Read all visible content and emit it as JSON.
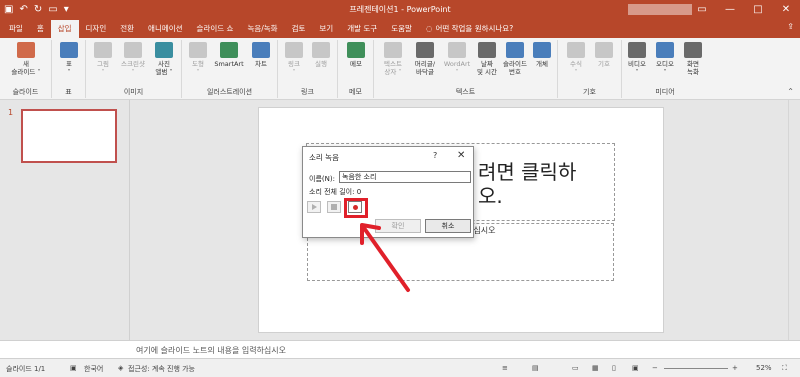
{
  "window": {
    "title": "프레젠테이션1 - PowerPoint",
    "qat_icons": [
      "save-icon",
      "undo-icon",
      "redo-icon",
      "start-slideshow-icon",
      "customize-icon"
    ],
    "controls": [
      "minimize-icon",
      "restore-icon",
      "maximize-icon",
      "close-icon"
    ]
  },
  "tabs": [
    "파일",
    "홈",
    "삽입",
    "디자인",
    "전환",
    "애니메이션",
    "슬라이드 쇼",
    "녹음/녹화",
    "검토",
    "보기",
    "개발 도구",
    "도움말"
  ],
  "tell_me": "어떤 작업을 원하시나요?",
  "share_icon": "share-icon",
  "ribbon": {
    "groups": [
      {
        "label": "슬라이드",
        "buttons": [
          {
            "label": "새\n슬라이드 ˅",
            "icon": "new-slide-icon",
            "enabled": true
          }
        ]
      },
      {
        "label": "표",
        "buttons": [
          {
            "label": "표\n˅",
            "icon": "table-icon",
            "enabled": true
          }
        ]
      },
      {
        "label": "이미지",
        "buttons": [
          {
            "label": "그림\n˅",
            "icon": "picture-icon",
            "enabled": false
          },
          {
            "label": "스크린샷\n˅",
            "icon": "screenshot-icon",
            "enabled": false
          },
          {
            "label": "사진\n앨범 ˅",
            "icon": "photo-album-icon",
            "enabled": true
          }
        ]
      },
      {
        "label": "일러스트레이션",
        "buttons": [
          {
            "label": "도형\n˅",
            "icon": "shapes-icon",
            "enabled": false
          },
          {
            "label": "SmartArt",
            "icon": "smartart-icon",
            "enabled": true
          },
          {
            "label": "차트",
            "icon": "chart-icon",
            "enabled": true
          }
        ]
      },
      {
        "label": "링크",
        "buttons": [
          {
            "label": "링크\n˅",
            "icon": "link-icon",
            "enabled": false
          },
          {
            "label": "실행",
            "icon": "action-icon",
            "enabled": false
          }
        ]
      },
      {
        "label": "메모",
        "buttons": [
          {
            "label": "메모",
            "icon": "comment-icon",
            "enabled": true
          }
        ]
      },
      {
        "label": "텍스트",
        "buttons": [
          {
            "label": "텍스트\n상자 ˅",
            "icon": "textbox-icon",
            "enabled": false
          },
          {
            "label": "머리글/\n바닥글",
            "icon": "header-footer-icon",
            "enabled": true
          },
          {
            "label": "WordArt\n˅",
            "icon": "wordart-icon",
            "enabled": false
          },
          {
            "label": "날짜\n및 시간",
            "icon": "date-time-icon",
            "enabled": true
          },
          {
            "label": "슬라이드\n번호",
            "icon": "slide-number-icon",
            "enabled": true
          },
          {
            "label": "개체",
            "icon": "object-icon",
            "enabled": true
          }
        ]
      },
      {
        "label": "기호",
        "buttons": [
          {
            "label": "수식\n˅",
            "icon": "equation-icon",
            "enabled": false
          },
          {
            "label": "기호",
            "icon": "symbol-icon",
            "enabled": false
          }
        ]
      },
      {
        "label": "미디어",
        "buttons": [
          {
            "label": "비디오\n˅",
            "icon": "video-icon",
            "enabled": true
          },
          {
            "label": "오디오\n˅",
            "icon": "audio-icon",
            "enabled": true
          },
          {
            "label": "화면\n녹화",
            "icon": "screen-recording-icon",
            "enabled": true
          }
        ]
      }
    ]
  },
  "thumbnails": {
    "number": "1"
  },
  "slide": {
    "title_fragment": "려면 클릭하\n오.",
    "subtitle_fragment": "하십시오"
  },
  "dialog": {
    "title": "소리 녹음",
    "help": "?",
    "close": "✕",
    "name_label": "이름(N):",
    "name_value": "녹음한 소리",
    "length_label": "소리 전체 길이:",
    "length_value": "0",
    "ok": "확인",
    "cancel": "취소",
    "controls": [
      "play-icon",
      "stop-icon",
      "record-icon"
    ]
  },
  "notes": {
    "placeholder": "여기에 슬라이드 노트의 내용을 입력하십시오"
  },
  "status": {
    "slide": "슬라이드 1/1",
    "language": "한국어",
    "accessibility": "접근성: 계속 진행 가능",
    "zoom": "52%"
  },
  "colors": {
    "accent": "#b7472a",
    "highlight": "#e0202a"
  }
}
